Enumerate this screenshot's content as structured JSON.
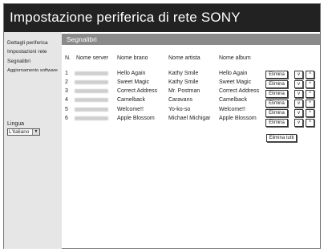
{
  "window": {
    "title": "Impostazione periferica di rete SONY"
  },
  "sidebar": {
    "items": [
      {
        "label": "Dettagli periferica"
      },
      {
        "label": "Impostazioni rete"
      },
      {
        "label": "Segnalibri"
      },
      {
        "label": "Aggiornamento software"
      }
    ],
    "language_label": "Lingua",
    "language_value": "L'italiano"
  },
  "section": {
    "title": "Segnalibri"
  },
  "table": {
    "headers": {
      "n": "N.",
      "server": "Nome server",
      "track": "Nome brano",
      "artist": "Nome artista",
      "album": "Nome album"
    },
    "rows": [
      {
        "n": "1",
        "track": "Hello Again",
        "artist": "Kathy Smile",
        "album": "Hello Again"
      },
      {
        "n": "2",
        "track": "Sweet Magic",
        "artist": "Kathy Smile",
        "album": "Sweet Magic"
      },
      {
        "n": "3",
        "track": "Correct Address",
        "artist": "Mr. Postman",
        "album": "Correct Address"
      },
      {
        "n": "4",
        "track": "Camelback",
        "artist": "Caravans",
        "album": "Camelback"
      },
      {
        "n": "5",
        "track": "Welcome!!",
        "artist": "Yo-ko-so",
        "album": "Welcome!!"
      },
      {
        "n": "6",
        "track": "Apple Blossom",
        "artist": "Michael Michigar",
        "album": "Apple Blossom"
      }
    ],
    "delete_label": "Elimina",
    "move_down_label": "v",
    "move_up_label": "^",
    "delete_all_label": "Elimina tutti"
  }
}
